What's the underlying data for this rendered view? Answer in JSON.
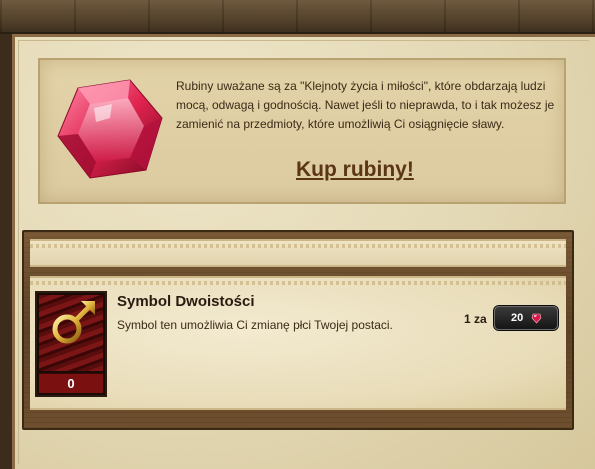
{
  "info": {
    "description": "Rubiny uważane są za \"Klejnoty życia i miłości\", które obdarzają ludzi mocą, odwagą i godnością. Nawet jeśli to nieprawda, to i tak możesz je zamienić na przedmioty, które umożliwią Ci osiągnięcie sławy.",
    "buy_link": "Kup rubiny!",
    "ruby_icon": "ruby-gem-icon"
  },
  "item": {
    "title": "Symbol Dwoistości",
    "description": "Symbol ten umożliwia Ci zmianę płci Twojej postaci.",
    "count": "0",
    "icon": "gender-symbol-icon",
    "price_label": "1 za",
    "price_value": "20",
    "price_icon": "ruby-icon"
  },
  "colors": {
    "link": "#5a3516",
    "thumb_count_bg": "#7a1010",
    "price_button_bg": "#151515",
    "ruby": "#d41a4a"
  }
}
